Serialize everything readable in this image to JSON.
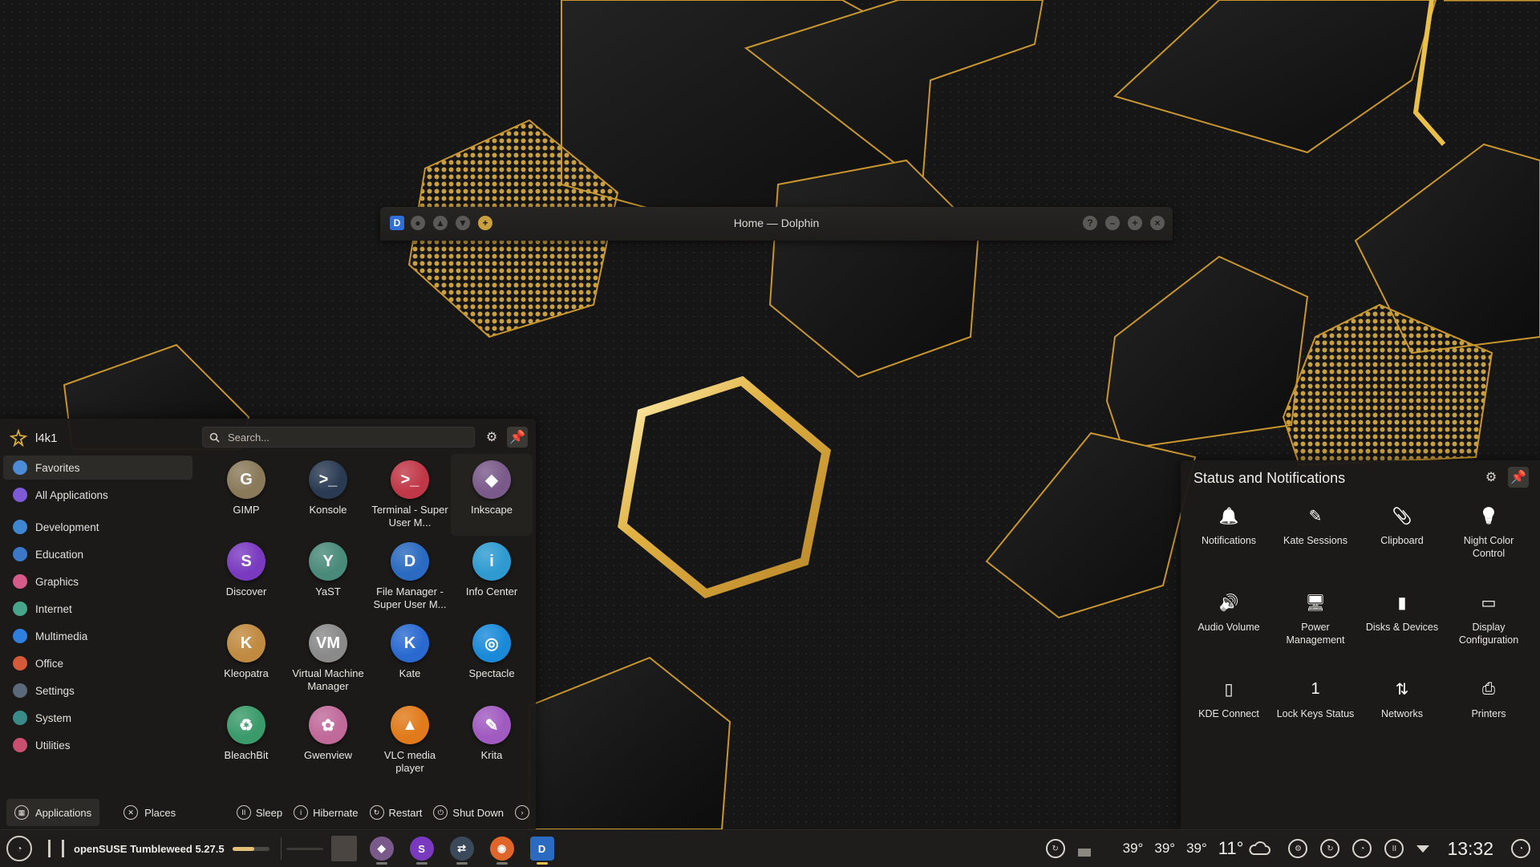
{
  "wallpaper": {
    "accent": "#d9a93a",
    "base": "#141414"
  },
  "dolphin": {
    "title": "Home — Dolphin"
  },
  "launcher": {
    "username": "l4k1",
    "search_placeholder": "Search...",
    "categories": [
      {
        "label": "Favorites",
        "color": "#4c8bd6"
      },
      {
        "label": "All Applications",
        "color": "#7d5ad6"
      },
      {
        "label": "Development",
        "color": "#3e86d0"
      },
      {
        "label": "Education",
        "color": "#3b78c8"
      },
      {
        "label": "Graphics",
        "color": "#d65a8a"
      },
      {
        "label": "Internet",
        "color": "#46a58a"
      },
      {
        "label": "Multimedia",
        "color": "#2f7fe0"
      },
      {
        "label": "Office",
        "color": "#d45a3a"
      },
      {
        "label": "Settings",
        "color": "#5b6a7a"
      },
      {
        "label": "System",
        "color": "#3a8a8a"
      },
      {
        "label": "Utilities",
        "color": "#c94f6f"
      }
    ],
    "apps": [
      {
        "label": "GIMP",
        "icon": "gimp-icon",
        "color": "#8a7a5a",
        "glyph": "G"
      },
      {
        "label": "Konsole",
        "icon": "konsole-icon",
        "color": "#2a3a52",
        "glyph": ">_"
      },
      {
        "label": "Terminal - Super User M...",
        "icon": "terminal-su-icon",
        "color": "#c03848",
        "glyph": ">_"
      },
      {
        "label": "Inkscape",
        "icon": "inkscape-icon",
        "color": "#7a5a8a",
        "glyph": "◆"
      },
      {
        "label": "Discover",
        "icon": "discover-icon",
        "color": "#7a3ac0",
        "glyph": "S"
      },
      {
        "label": "YaST",
        "icon": "yast-icon",
        "color": "#4a8a7a",
        "glyph": "Y"
      },
      {
        "label": "File Manager - Super User M...",
        "icon": "file-manager-su-icon",
        "color": "#2a6ac0",
        "glyph": "D"
      },
      {
        "label": "Info Center",
        "icon": "info-center-icon",
        "color": "#2e9ad0",
        "glyph": "i"
      },
      {
        "label": "Kleopatra",
        "icon": "kleopatra-icon",
        "color": "#c08a40",
        "glyph": "K"
      },
      {
        "label": "Virtual Machine Manager",
        "icon": "virt-manager-icon",
        "color": "#8a8a8a",
        "glyph": "VM"
      },
      {
        "label": "Kate",
        "icon": "kate-icon",
        "color": "#2a6ad0",
        "glyph": "K"
      },
      {
        "label": "Spectacle",
        "icon": "spectacle-icon",
        "color": "#1a8ad8",
        "glyph": "◎"
      },
      {
        "label": "BleachBit",
        "icon": "bleachbit-icon",
        "color": "#3a9a6a",
        "glyph": "♻"
      },
      {
        "label": "Gwenview",
        "icon": "gwenview-icon",
        "color": "#c06a9a",
        "glyph": "✿"
      },
      {
        "label": "VLC media player",
        "icon": "vlc-icon",
        "color": "#e07a1a",
        "glyph": "▲"
      },
      {
        "label": "Krita",
        "icon": "krita-icon",
        "color": "#a05ac0",
        "glyph": "✎"
      }
    ],
    "footer": {
      "applications": "Applications",
      "places": "Places",
      "sleep": "Sleep",
      "hibernate": "Hibernate",
      "restart": "Restart",
      "shutdown": "Shut Down"
    }
  },
  "status": {
    "title": "Status and Notifications",
    "items": [
      {
        "label": "Notifications",
        "icon": "bell-icon"
      },
      {
        "label": "Kate Sessions",
        "icon": "kate-sessions-icon"
      },
      {
        "label": "Clipboard",
        "icon": "clipboard-icon"
      },
      {
        "label": "Night Color Control",
        "icon": "night-color-icon"
      },
      {
        "label": "Audio Volume",
        "icon": "speaker-icon"
      },
      {
        "label": "Power Management",
        "icon": "monitor-power-icon"
      },
      {
        "label": "Disks & Devices",
        "icon": "usb-drive-icon"
      },
      {
        "label": "Display Configuration",
        "icon": "display-icon"
      },
      {
        "label": "KDE Connect",
        "icon": "phone-icon"
      },
      {
        "label": "Lock Keys Status",
        "icon": "lock-keys-icon"
      },
      {
        "label": "Networks",
        "icon": "network-icon"
      },
      {
        "label": "Printers",
        "icon": "printer-icon"
      }
    ]
  },
  "panel": {
    "distro": "openSUSE Tumbleweed 5.27.5",
    "volume_level": 0.6,
    "temps": [
      "39°",
      "39°",
      "39°"
    ],
    "weather_temp": "11°",
    "clock": "13:32"
  }
}
